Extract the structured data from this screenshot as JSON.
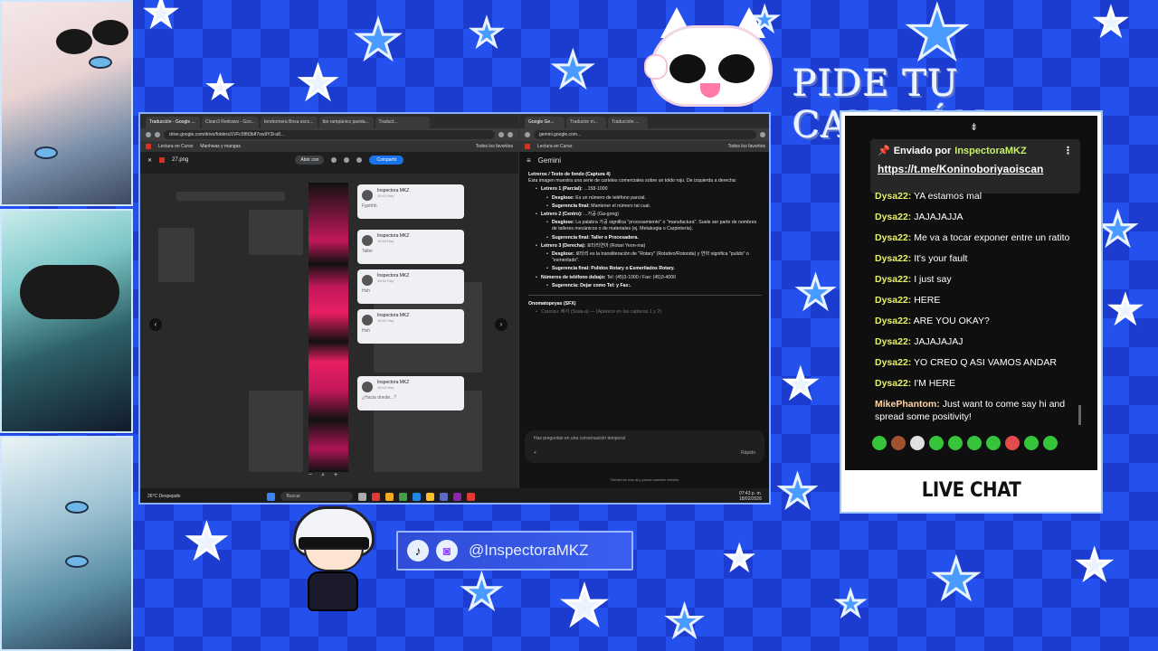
{
  "overlay": {
    "title_banner": "PIDE TU CANCIÓN",
    "chat_label": "LIVE CHAT",
    "social_handle": "@InspectoraMKZ",
    "social_icons": [
      "tiktok-icon",
      "twitch-icon"
    ]
  },
  "browser_left": {
    "tabs": [
      "Traducción - Google ...",
      "Clean3 Redraws - Goo...",
      "tondromera Bova esco...",
      "tbo rampánico pueda...",
      "Traduct..."
    ],
    "url": "drive.google.com/drive/folders/1VFc5f8t3bIf7ow9Y3l-a8...",
    "bookmarks": [
      "Lectura en Curso",
      "Manhwas y mangas",
      "Todos los favoritos"
    ],
    "file_name": "27.png",
    "open_with": "Abrir con",
    "share": "Compartir",
    "bubbles": [
      {
        "name": "Inspectora MKZ",
        "time": "19:41 Hoy",
        "msg": "Fgshhh"
      },
      {
        "name": "Inspectora MKZ",
        "time": "19:43 Hoy",
        "msg": "Taller"
      },
      {
        "name": "Inspectora MKZ",
        "time": "19:41 Hoy",
        "msg": "Hsh"
      },
      {
        "name": "Inspectora MKZ",
        "time": "19:41 Hoy",
        "msg": "Hsh"
      },
      {
        "name": "Inspectora MKZ",
        "time": "19:42 Hoy",
        "msg": "¿Hacia donde...?"
      }
    ]
  },
  "browser_right": {
    "tabs": [
      "Google Ge...",
      "Traductor m...",
      "Traducción ..."
    ],
    "url": "gemini.google.com...",
    "bookmarks": [
      "Lectura en Curso",
      "Todos los favoritos"
    ],
    "app_title": "Gemini",
    "content": {
      "heading": "Letreros / Texto de fondo (Captura 4)",
      "intro": "Esta imagen muestra una serie de carteles comerciales sobre un toldo rojo. De izquierda a derecha:",
      "item1_title": "Letrero 1 (Parcial):",
      "item1_value": "...158-1000",
      "item1_breakdown_label": "Desglose:",
      "item1_breakdown": "Es un número de teléfono parcial.",
      "item1_sugg_label": "Sugerencia final:",
      "item1_sugg": "Mantener el número tal cual.",
      "item2_title": "Letrero 2 (Centro):",
      "item2_value": "...가공 (Ga-gong)",
      "item2_breakdown_label": "Desglose:",
      "item2_breakdown": "La palabra 가공 significa \"procesamiento\" o \"manufactura\". Suele ser parte de nombres de talleres mecánicos o de materiales (ej. Metalurgia o Carpintería).",
      "item2_sugg_label": "Sugerencia final:",
      "item2_sugg": "Taller o Procesadora.",
      "item3_title": "Letrero 3 (Derecha):",
      "item3_value": "로타리연마 (Rotari Yeon-ma)",
      "item3_breakdown_label": "Desglose:",
      "item3_breakdown": "로타리 es la transliteración de \"Rotary\" (Rotativo/Rotonda) y 연마 significa \"pulido\" o \"esmerilado\".",
      "item3_sugg_label": "Sugerencia final:",
      "item3_sugg": "Pulidos Rotary o Esmerilados Rotary.",
      "item4_title": "Números de teléfono debajo:",
      "item4_value": "Tel: (45)3-1000 / Fax: (45)3-4000",
      "item4_sugg_label": "Sugerencia:",
      "item4_sugg": "Dejar como Tel: y Fax:.",
      "section2": "Onomatopeyas (SFX)",
      "section2_cut": "Crasssu: 삐걱 (Ssaa-a) — (Aparece en las capturas 1 y 2)"
    },
    "input_placeholder": "Haz preguntas en una conversación temporal",
    "mode": "Rápido",
    "footer": "Gemini es una IA y puede cometer errores."
  },
  "taskbar": {
    "weather": "26°C Despejado",
    "search": "Buscar",
    "clock": "07:43 p. m.",
    "date": "18/02/2026"
  },
  "chat": {
    "pinned_label": "Enviado por",
    "pinned_user": "InspectoraMKZ",
    "pinned_link": "https://t.me/Koninoboriyaoiscan",
    "messages": [
      {
        "user": "Dysa22:",
        "text": "YA estamos mal"
      },
      {
        "user": "Dysa22:",
        "text": "JAJAJAJJA"
      },
      {
        "user": "Dysa22:",
        "text": "Me va a tocar exponer entre un ratito"
      },
      {
        "user": "Dysa22:",
        "text": "It's your fault"
      },
      {
        "user": "Dysa22:",
        "text": "I just say"
      },
      {
        "user": "Dysa22:",
        "text": "HERE"
      },
      {
        "user": "Dysa22:",
        "text": "ARE YOU OKAY?"
      },
      {
        "user": "Dysa22:",
        "text": "JAJAJAJAJ"
      },
      {
        "user": "Dysa22:",
        "text": "YO CREO Q ASI VAMOS ANDAR"
      },
      {
        "user": "Dysa22:",
        "text": "I'M HERE"
      },
      {
        "user": "MikePhantom:",
        "text": "Just want to come say hi and spread some positivity!"
      }
    ],
    "emote_colors": [
      "#35c43a",
      "#a0522d",
      "#e0e0e0",
      "#35c43a",
      "#35c43a",
      "#35c43a",
      "#35c43a",
      "#e34b4b",
      "#35c43a",
      "#35c43a"
    ]
  },
  "colors": {
    "background": "#1f3fd6",
    "star": "#3d8bff",
    "chat_user": "#e8f26a",
    "accent_share": "#1a73e8"
  }
}
